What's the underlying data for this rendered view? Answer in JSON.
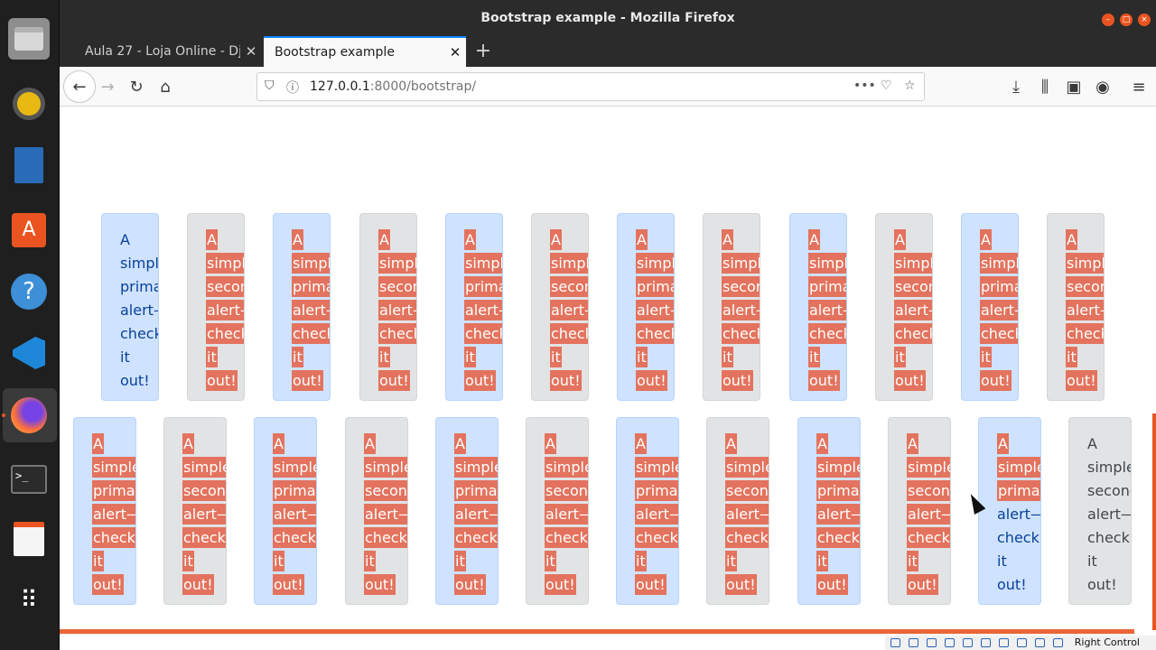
{
  "window": {
    "title": "Bootstrap example - Mozilla Firefox"
  },
  "tabs": [
    {
      "label": "Aula 27 - Loja Online - Dj",
      "active": false
    },
    {
      "label": "Bootstrap example",
      "active": true
    }
  ],
  "navbar": {
    "url_host": "127.0.0.1",
    "url_path": ":8000/bootstrap/"
  },
  "alerts": {
    "primary_text": [
      "A",
      "simple",
      "primary",
      "alert—",
      "check",
      "it",
      "out!"
    ],
    "secondary_text": [
      "A",
      "simple",
      "secondary",
      "alert—",
      "check",
      "it",
      "out!"
    ]
  },
  "tray": {
    "label": "Right Control"
  },
  "colors": {
    "primary_bg": "#cfe2ff",
    "secondary_bg": "#e2e3e5",
    "highlight": "#e3735e"
  }
}
